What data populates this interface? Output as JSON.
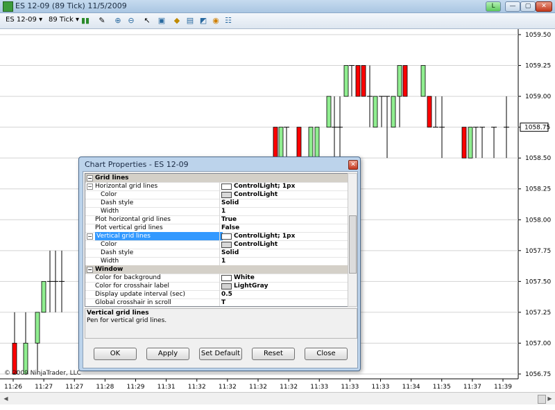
{
  "window": {
    "title": "ES 12-09 (89 Tick)  11/5/2009",
    "buttons": {
      "link": "L",
      "minimize": "—",
      "restore": "▢",
      "close": "✕"
    }
  },
  "toolbar": {
    "instrument": "ES 12-09",
    "interval": "89 Tick",
    "icons": [
      "bar-type-icon",
      "pencil-icon",
      "zoom-in-icon",
      "zoom-out-icon",
      "cursor-icon",
      "properties-icon",
      "strategy-icon",
      "chart-icon",
      "indicator-icon",
      "clock-icon",
      "data-box-icon"
    ]
  },
  "chart": {
    "y_axis": {
      "ticks": [
        "1059.50",
        "1059.25",
        "1059.00",
        "1058.75",
        "1058.50",
        "1058.25",
        "1058.00",
        "1057.75",
        "1057.50",
        "1057.25",
        "1057.00",
        "1056.75"
      ],
      "current_price": "1058.75"
    },
    "x_axis": {
      "ticks": [
        "11:26",
        "11:27",
        "11:27",
        "11:28",
        "11:29",
        "11:31",
        "11:32",
        "11:32",
        "11:32",
        "11:32",
        "11:33",
        "11:33",
        "11:33",
        "11:34",
        "11:35",
        "11:37",
        "11:39"
      ]
    },
    "copyright": "© 2009 NinjaTrader, LLC",
    "colors": {
      "up": "#90ee90",
      "down": "#ff0000",
      "wick": "#000000",
      "grid": "#d3d3d3"
    }
  },
  "chart_data": {
    "type": "candlestick",
    "title": "ES 12-09 (89 Tick)",
    "ylim": [
      1056.75,
      1059.5
    ],
    "bars": [
      {
        "t": 0,
        "o": 1057.0,
        "c": 1056.75,
        "h": 1057.25,
        "l": 1056.75
      },
      {
        "t": 1,
        "o": 1056.75,
        "c": 1057.0,
        "h": 1057.25,
        "l": 1056.75
      },
      {
        "t": 2,
        "o": 1057.0,
        "c": 1057.25,
        "h": 1057.25,
        "l": 1056.75
      },
      {
        "t": 3,
        "o": 1057.25,
        "c": 1057.5,
        "h": 1057.5,
        "l": 1057.25
      },
      {
        "t": 4,
        "o": 1057.5,
        "c": 1057.5,
        "h": 1057.75,
        "l": 1057.25
      },
      {
        "t": 5,
        "o": 1057.5,
        "c": 1057.5,
        "h": 1057.75,
        "l": 1057.25
      },
      {
        "t": 6,
        "o": 1057.5,
        "c": 1057.5,
        "h": 1057.75,
        "l": 1057.25
      },
      {
        "t": 7,
        "o": 1058.75,
        "c": 1058.5,
        "h": 1058.75,
        "l": 1058.5
      },
      {
        "t": 8,
        "o": 1058.5,
        "c": 1058.75,
        "h": 1058.75,
        "l": 1058.5
      },
      {
        "t": 9,
        "o": 1058.75,
        "c": 1058.75,
        "h": 1058.75,
        "l": 1058.5
      },
      {
        "t": 10,
        "o": 1058.75,
        "c": 1058.5,
        "h": 1058.75,
        "l": 1058.5
      },
      {
        "t": 11,
        "o": 1058.5,
        "c": 1058.75,
        "h": 1058.75,
        "l": 1058.5
      },
      {
        "t": 12,
        "o": 1058.5,
        "c": 1058.75,
        "h": 1058.75,
        "l": 1058.5
      },
      {
        "t": 13,
        "o": 1058.75,
        "c": 1059.0,
        "h": 1059.0,
        "l": 1058.75
      },
      {
        "t": 14,
        "o": 1058.75,
        "c": 1058.75,
        "h": 1059.0,
        "l": 1058.5
      },
      {
        "t": 15,
        "o": 1058.75,
        "c": 1058.75,
        "h": 1059.0,
        "l": 1058.5
      },
      {
        "t": 16,
        "o": 1059.0,
        "c": 1059.25,
        "h": 1059.25,
        "l": 1059.0
      },
      {
        "t": 17,
        "o": 1059.25,
        "c": 1059.25,
        "h": 1059.25,
        "l": 1059.0
      },
      {
        "t": 18,
        "o": 1059.25,
        "c": 1059.0,
        "h": 1059.25,
        "l": 1059.0
      },
      {
        "t": 19,
        "o": 1059.25,
        "c": 1059.0,
        "h": 1059.25,
        "l": 1059.0
      },
      {
        "t": 20,
        "o": 1059.0,
        "c": 1059.0,
        "h": 1059.25,
        "l": 1058.75
      },
      {
        "t": 21,
        "o": 1058.75,
        "c": 1059.0,
        "h": 1059.0,
        "l": 1058.75
      },
      {
        "t": 22,
        "o": 1059.0,
        "c": 1059.0,
        "h": 1059.0,
        "l": 1058.75
      },
      {
        "t": 23,
        "o": 1059.0,
        "c": 1059.0,
        "h": 1059.0,
        "l": 1058.5
      },
      {
        "t": 24,
        "o": 1058.75,
        "c": 1059.0,
        "h": 1059.0,
        "l": 1058.75
      },
      {
        "t": 25,
        "o": 1059.0,
        "c": 1059.25,
        "h": 1059.25,
        "l": 1058.75
      },
      {
        "t": 26,
        "o": 1059.25,
        "c": 1059.0,
        "h": 1059.25,
        "l": 1059.0
      },
      {
        "t": 27,
        "o": 1059.0,
        "c": 1059.25,
        "h": 1059.25,
        "l": 1059.0
      },
      {
        "t": 28,
        "o": 1059.0,
        "c": 1058.75,
        "h": 1059.0,
        "l": 1058.75
      },
      {
        "t": 29,
        "o": 1058.75,
        "c": 1058.75,
        "h": 1059.0,
        "l": 1058.75
      },
      {
        "t": 30,
        "o": 1058.75,
        "c": 1058.75,
        "h": 1059.0,
        "l": 1058.5
      },
      {
        "t": 31,
        "o": 1058.75,
        "c": 1058.5,
        "h": 1058.75,
        "l": 1058.5
      },
      {
        "t": 32,
        "o": 1058.5,
        "c": 1058.75,
        "h": 1058.75,
        "l": 1058.5
      },
      {
        "t": 33,
        "o": 1058.75,
        "c": 1058.75,
        "h": 1058.75,
        "l": 1058.5
      },
      {
        "t": 34,
        "o": 1058.75,
        "c": 1058.75,
        "h": 1058.75,
        "l": 1058.5
      },
      {
        "t": 35,
        "o": 1058.75,
        "c": 1058.75,
        "h": 1058.75,
        "l": 1058.5
      },
      {
        "t": 36,
        "o": 1058.75,
        "c": 1058.75,
        "h": 1059.0,
        "l": 1058.5
      }
    ]
  },
  "dialog": {
    "title": "Chart Properties - ES 12-09",
    "close": "✕",
    "rows": [
      {
        "kind": "cat",
        "expander": "⊟",
        "name": "Grid lines"
      },
      {
        "kind": "group",
        "expander": "⊟",
        "name": "Horizontal grid lines",
        "swatch": "#ffffff",
        "value": "ControlLight; 1px"
      },
      {
        "kind": "sub",
        "name": "Color",
        "swatch": "#d8d8d8",
        "value": "ControlLight"
      },
      {
        "kind": "sub",
        "name": "Dash style",
        "value": "Solid"
      },
      {
        "kind": "sub",
        "name": "Width",
        "value": "1"
      },
      {
        "kind": "prop",
        "name": "Plot horizontal grid lines",
        "value": "True"
      },
      {
        "kind": "prop",
        "name": "Plot vertical grid lines",
        "value": "False"
      },
      {
        "kind": "group",
        "expander": "⊟",
        "name": "Vertical grid lines",
        "swatch": "#ffffff",
        "value": "ControlLight; 1px",
        "selected": true
      },
      {
        "kind": "sub",
        "name": "Color",
        "swatch": "#d8d8d8",
        "value": "ControlLight"
      },
      {
        "kind": "sub",
        "name": "Dash style",
        "value": "Solid"
      },
      {
        "kind": "sub",
        "name": "Width",
        "value": "1"
      },
      {
        "kind": "cat",
        "expander": "⊟",
        "name": "Window"
      },
      {
        "kind": "prop",
        "name": "Color for background",
        "swatch": "#ffffff",
        "value": "White"
      },
      {
        "kind": "prop",
        "name": "Color for crosshair label",
        "swatch": "#d3d3d3",
        "value": "LightGray"
      },
      {
        "kind": "prop",
        "name": "Display update interval (sec)",
        "value": "0.5"
      },
      {
        "kind": "prop",
        "name": "Global crosshair in scroll",
        "value": "T"
      }
    ],
    "description": {
      "heading": "Vertical grid lines",
      "text": "Pen for vertical grid lines."
    },
    "buttons": [
      "OK",
      "Apply",
      "Set Default",
      "Reset",
      "Close"
    ]
  }
}
